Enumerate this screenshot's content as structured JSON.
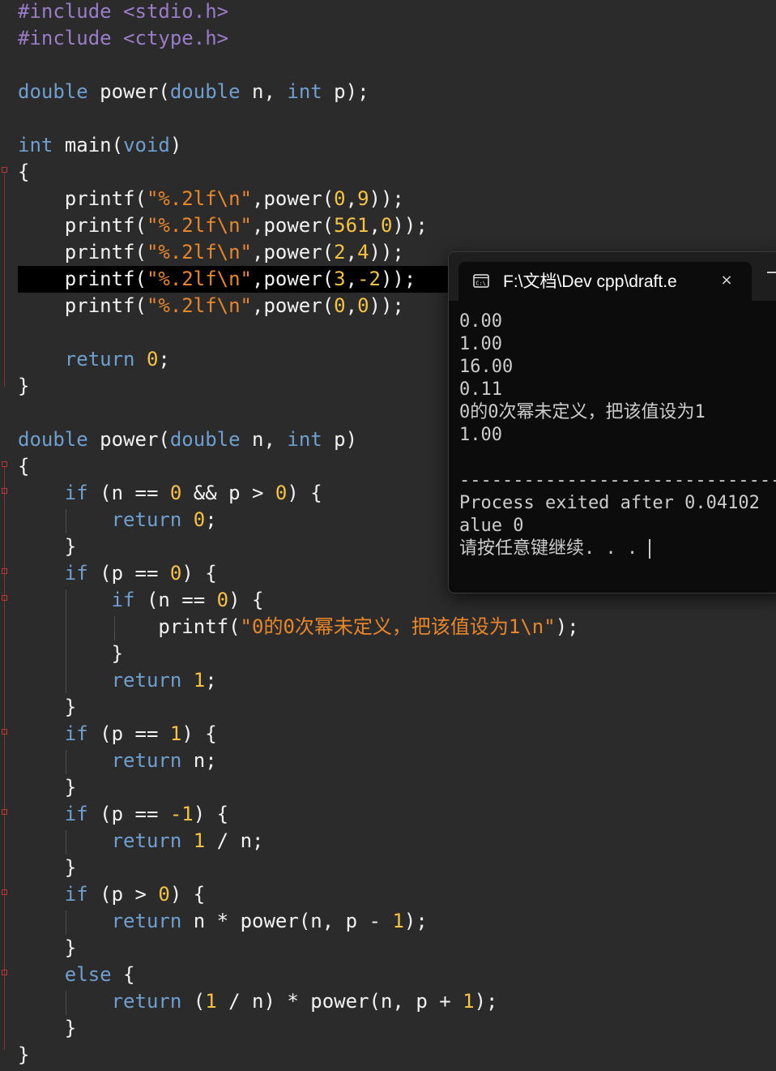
{
  "editor": {
    "lines": [
      [
        [
          "pre",
          "#include <stdio.h>"
        ]
      ],
      [
        [
          "pre",
          "#include <ctype.h>"
        ]
      ],
      [],
      [
        [
          "kw",
          "double"
        ],
        [
          "id",
          " power"
        ],
        [
          "pun",
          "("
        ],
        [
          "kw",
          "double"
        ],
        [
          "id",
          " n"
        ],
        [
          "pun",
          ", "
        ],
        [
          "kw",
          "int"
        ],
        [
          "id",
          " p"
        ],
        [
          "pun",
          ");"
        ]
      ],
      [],
      [
        [
          "kw",
          "int"
        ],
        [
          "id",
          " main"
        ],
        [
          "pun",
          "("
        ],
        [
          "kw",
          "void"
        ],
        [
          "pun",
          ")"
        ]
      ],
      [
        [
          "pun",
          "{"
        ]
      ],
      [
        [
          "id",
          "    printf"
        ],
        [
          "pun",
          "("
        ],
        [
          "str",
          "\"%.2lf\\n\""
        ],
        [
          "pun",
          ","
        ],
        [
          "id",
          "power"
        ],
        [
          "pun",
          "("
        ],
        [
          "num",
          "0"
        ],
        [
          "pun",
          ","
        ],
        [
          "num",
          "9"
        ],
        [
          "pun",
          "));"
        ]
      ],
      [
        [
          "id",
          "    printf"
        ],
        [
          "pun",
          "("
        ],
        [
          "str",
          "\"%.2lf\\n\""
        ],
        [
          "pun",
          ","
        ],
        [
          "id",
          "power"
        ],
        [
          "pun",
          "("
        ],
        [
          "num",
          "561"
        ],
        [
          "pun",
          ","
        ],
        [
          "num",
          "0"
        ],
        [
          "pun",
          "));"
        ]
      ],
      [
        [
          "id",
          "    printf"
        ],
        [
          "pun",
          "("
        ],
        [
          "str",
          "\"%.2lf\\n\""
        ],
        [
          "pun",
          ","
        ],
        [
          "id",
          "power"
        ],
        [
          "pun",
          "("
        ],
        [
          "num",
          "2"
        ],
        [
          "pun",
          ","
        ],
        [
          "num",
          "4"
        ],
        [
          "pun",
          "));"
        ]
      ],
      [
        [
          "id",
          "    printf"
        ],
        [
          "pun",
          "("
        ],
        [
          "str",
          "\"%.2lf\\n\""
        ],
        [
          "pun",
          ","
        ],
        [
          "id",
          "power"
        ],
        [
          "pun",
          "("
        ],
        [
          "num",
          "3"
        ],
        [
          "pun",
          ","
        ],
        [
          "num",
          "-2"
        ],
        [
          "pun",
          "));"
        ]
      ],
      [
        [
          "id",
          "    printf"
        ],
        [
          "pun",
          "("
        ],
        [
          "str",
          "\"%.2lf\\n\""
        ],
        [
          "pun",
          ","
        ],
        [
          "id",
          "power"
        ],
        [
          "pun",
          "("
        ],
        [
          "num",
          "0"
        ],
        [
          "pun",
          ","
        ],
        [
          "num",
          "0"
        ],
        [
          "pun",
          "));"
        ]
      ],
      [],
      [
        [
          "kw",
          "    return"
        ],
        [
          "pun",
          " "
        ],
        [
          "num",
          "0"
        ],
        [
          "pun",
          ";"
        ]
      ],
      [
        [
          "pun",
          "}"
        ]
      ],
      [],
      [
        [
          "kw",
          "double"
        ],
        [
          "id",
          " power"
        ],
        [
          "pun",
          "("
        ],
        [
          "kw",
          "double"
        ],
        [
          "id",
          " n"
        ],
        [
          "pun",
          ", "
        ],
        [
          "kw",
          "int"
        ],
        [
          "id",
          " p"
        ],
        [
          "pun",
          ")"
        ]
      ],
      [
        [
          "pun",
          "{"
        ]
      ],
      [
        [
          "kw",
          "    if"
        ],
        [
          "pun",
          " ("
        ],
        [
          "id",
          "n"
        ],
        [
          "pun",
          " == "
        ],
        [
          "num",
          "0"
        ],
        [
          "pun",
          " && "
        ],
        [
          "id",
          "p"
        ],
        [
          "pun",
          " > "
        ],
        [
          "num",
          "0"
        ],
        [
          "pun",
          ") {"
        ]
      ],
      [
        [
          "kw",
          "        return"
        ],
        [
          "pun",
          " "
        ],
        [
          "num",
          "0"
        ],
        [
          "pun",
          ";"
        ]
      ],
      [
        [
          "pun",
          "    }"
        ]
      ],
      [
        [
          "kw",
          "    if"
        ],
        [
          "pun",
          " ("
        ],
        [
          "id",
          "p"
        ],
        [
          "pun",
          " == "
        ],
        [
          "num",
          "0"
        ],
        [
          "pun",
          ") {"
        ]
      ],
      [
        [
          "kw",
          "        if"
        ],
        [
          "pun",
          " ("
        ],
        [
          "id",
          "n"
        ],
        [
          "pun",
          " == "
        ],
        [
          "num",
          "0"
        ],
        [
          "pun",
          ") {"
        ]
      ],
      [
        [
          "id",
          "            printf"
        ],
        [
          "pun",
          "("
        ],
        [
          "str",
          "\"0的0次幂未定义，把该值设为1\\n\""
        ],
        [
          "pun",
          ");"
        ]
      ],
      [
        [
          "pun",
          "        }"
        ]
      ],
      [
        [
          "kw",
          "        return"
        ],
        [
          "pun",
          " "
        ],
        [
          "num",
          "1"
        ],
        [
          "pun",
          ";"
        ]
      ],
      [
        [
          "pun",
          "    }"
        ]
      ],
      [
        [
          "kw",
          "    if"
        ],
        [
          "pun",
          " ("
        ],
        [
          "id",
          "p"
        ],
        [
          "pun",
          " == "
        ],
        [
          "num",
          "1"
        ],
        [
          "pun",
          ") {"
        ]
      ],
      [
        [
          "kw",
          "        return"
        ],
        [
          "id",
          " n"
        ],
        [
          "pun",
          ";"
        ]
      ],
      [
        [
          "pun",
          "    }"
        ]
      ],
      [
        [
          "kw",
          "    if"
        ],
        [
          "pun",
          " ("
        ],
        [
          "id",
          "p"
        ],
        [
          "pun",
          " == "
        ],
        [
          "num",
          "-1"
        ],
        [
          "pun",
          ") {"
        ]
      ],
      [
        [
          "kw",
          "        return"
        ],
        [
          "pun",
          " "
        ],
        [
          "num",
          "1"
        ],
        [
          "pun",
          " / "
        ],
        [
          "id",
          "n"
        ],
        [
          "pun",
          ";"
        ]
      ],
      [
        [
          "pun",
          "    }"
        ]
      ],
      [
        [
          "kw",
          "    if"
        ],
        [
          "pun",
          " ("
        ],
        [
          "id",
          "p"
        ],
        [
          "pun",
          " > "
        ],
        [
          "num",
          "0"
        ],
        [
          "pun",
          ") {"
        ]
      ],
      [
        [
          "kw",
          "        return"
        ],
        [
          "id",
          " n"
        ],
        [
          "pun",
          " * "
        ],
        [
          "id",
          "power"
        ],
        [
          "pun",
          "("
        ],
        [
          "id",
          "n"
        ],
        [
          "pun",
          ", "
        ],
        [
          "id",
          "p"
        ],
        [
          "pun",
          " - "
        ],
        [
          "num",
          "1"
        ],
        [
          "pun",
          ");"
        ]
      ],
      [
        [
          "pun",
          "    }"
        ]
      ],
      [
        [
          "kw",
          "    else"
        ],
        [
          "pun",
          " {"
        ]
      ],
      [
        [
          "kw",
          "        return"
        ],
        [
          "pun",
          " ("
        ],
        [
          "num",
          "1"
        ],
        [
          "pun",
          " / "
        ],
        [
          "id",
          "n"
        ],
        [
          "pun",
          ") * "
        ],
        [
          "id",
          "power"
        ],
        [
          "pun",
          "("
        ],
        [
          "id",
          "n"
        ],
        [
          "pun",
          ", "
        ],
        [
          "id",
          "p"
        ],
        [
          "pun",
          " + "
        ],
        [
          "num",
          "1"
        ],
        [
          "pun",
          ");"
        ]
      ],
      [
        [
          "pun",
          "    }"
        ]
      ],
      [
        [
          "pun",
          "}"
        ]
      ]
    ],
    "active_line_index": 10
  },
  "terminal": {
    "tab_title": "F:\\文档\\Dev cpp\\draft.e",
    "close_glyph": "×",
    "output_lines": [
      "0.00",
      "1.00",
      "16.00",
      "0.11",
      "0的0次幂未定义，把该值设为1",
      "1.00",
      "",
      "--------------------------------",
      "Process exited after 0.04102",
      "alue 0",
      "请按任意键继续. . ."
    ]
  },
  "icons": {
    "terminal_tab": "console-window-icon",
    "fold": "fold-marker-icon"
  },
  "colors": {
    "editor_background": "#2b2b2b",
    "keyword": "#6f9fcf",
    "preprocessor": "#9b7cc9",
    "number": "#f5c242",
    "string": "#e8862b",
    "identifier": "#f2f2f2",
    "active_line": "#000000",
    "terminal_background": "#0c0c0c",
    "fold_marker": "#b33a3a"
  }
}
